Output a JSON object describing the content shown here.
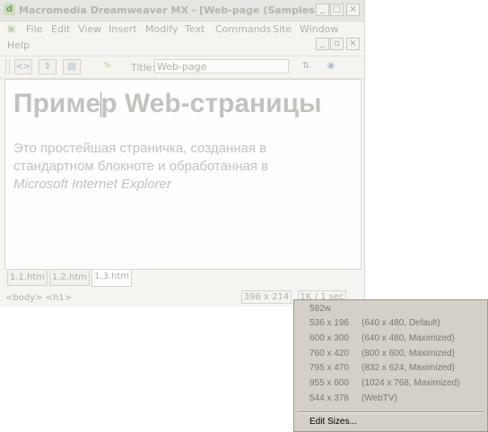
{
  "window": {
    "title": "Macromedia Dreamweaver MX - [Web-page (Samples/1...",
    "app_icon": "dreamweaver-icon",
    "caption_buttons": [
      "_",
      "□",
      "×"
    ]
  },
  "menubar": {
    "items": [
      "File",
      "Edit",
      "View",
      "Insert",
      "Modify",
      "Text",
      "Commands",
      "Site",
      "Window",
      "Help"
    ]
  },
  "doc_controls": [
    "_",
    "▫",
    "×"
  ],
  "toolbar": {
    "title_label": "Title:",
    "title_value": "Web-page"
  },
  "document": {
    "heading": "Пример Web-страницы",
    "body_line1": "Это простейшая страничка, созданная в",
    "body_line2": "стандартном блокноте и обработанная в",
    "body_line3": "Microsoft Internet Explorer"
  },
  "tabs": [
    "1.1.htm",
    "1.2.htm",
    "1.3.htm"
  ],
  "active_tab": "1.3.htm",
  "status": {
    "tag_selector": "<body> <h1>",
    "window_size": "396 x 214",
    "download": "1K / 1 sec"
  },
  "sizes_menu": {
    "items": [
      {
        "size": "592w",
        "desc": ""
      },
      {
        "size": "536 x 196",
        "desc": "(640 x 480, Default)"
      },
      {
        "size": "600 x 300",
        "desc": "(640 x 480, Maximized)"
      },
      {
        "size": "760 x 420",
        "desc": "(800 x 600, Maximized)"
      },
      {
        "size": "795 x 470",
        "desc": "(832 x 624, Maximized)"
      },
      {
        "size": "955 x 600",
        "desc": "(1024 x 768, Maximized)"
      },
      {
        "size": "544 x 378",
        "desc": "(WebTV)"
      }
    ],
    "edit_sizes": "Edit Sizes..."
  }
}
